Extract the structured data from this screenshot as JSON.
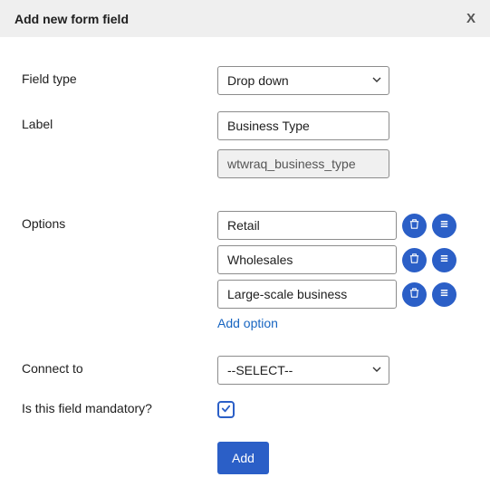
{
  "header": {
    "title": "Add new form field",
    "close": "X"
  },
  "fields": {
    "field_type": {
      "label": "Field type",
      "value": "Drop down"
    },
    "label": {
      "label": "Label",
      "value": "Business Type"
    },
    "slug": {
      "value": "wtwraq_business_type"
    },
    "options": {
      "label": "Options"
    },
    "connect_to": {
      "label": "Connect to",
      "value": "--SELECT--"
    },
    "mandatory": {
      "label": "Is this field mandatory?",
      "checked": true
    }
  },
  "option_items": [
    {
      "value": "Retail"
    },
    {
      "value": "Wholesales"
    },
    {
      "value": "Large-scale business"
    }
  ],
  "links": {
    "add_option": "Add option"
  },
  "buttons": {
    "submit": "Add"
  }
}
